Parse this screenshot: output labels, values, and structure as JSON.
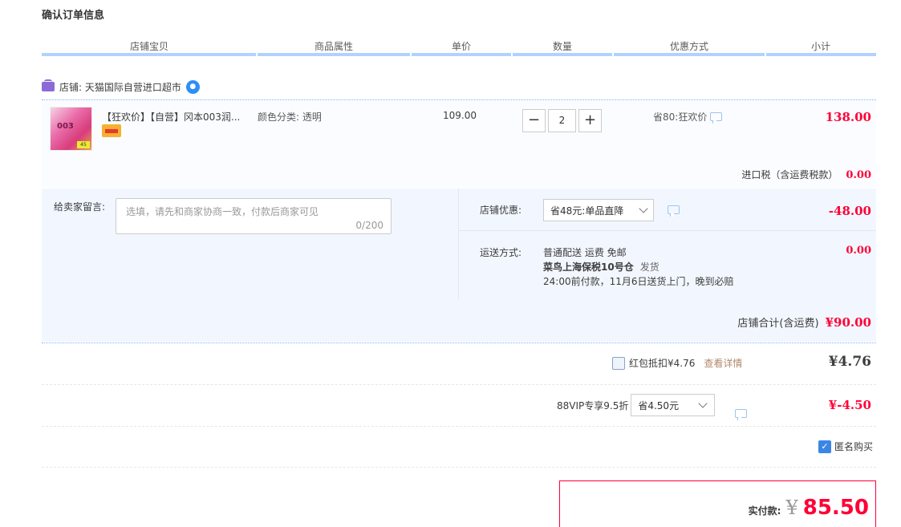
{
  "page": {
    "title": "确认订单信息"
  },
  "columns": [
    "店铺宝贝",
    "商品属性",
    "单价",
    "数量",
    "优惠方式",
    "小计"
  ],
  "shop": {
    "label": "店铺: 天猫国际自营进口超市"
  },
  "item": {
    "title": "【狂欢价】【自营】冈本003润...",
    "attribute": "颜色分类: 透明",
    "price": "109.00",
    "quantity": "2",
    "minus": "−",
    "plus": "+",
    "promo": "省80:狂欢价",
    "subtotal": "138.00",
    "thumb_text": "003",
    "thumb_badge": "45",
    "tax_label": "进口税（含运费税款）",
    "tax_value": "0.00"
  },
  "message": {
    "label": "给卖家留言:",
    "placeholder": "选填，请先和商家协商一致，付款后商家可见",
    "counter": "0/200"
  },
  "shop_discount": {
    "label": "店铺优惠:",
    "selected": "省48元:单品直降",
    "value": "-48.00"
  },
  "shipping": {
    "label": "运送方式:",
    "line1": "普通配送 运费 免邮",
    "line2_bold": "菜鸟上海保税10号仓",
    "line2_suffix": "发货",
    "line3": "24:00前付款，11月6日送货上门，晚到必赔",
    "value": "0.00"
  },
  "shop_total": {
    "label": "店铺合计(含运费)",
    "value": "¥90.00"
  },
  "red_packet": {
    "label": "红包抵扣¥4.76",
    "link": "查看详情",
    "value": "¥4.76",
    "checked": false
  },
  "vip": {
    "label": "88VIP专享9.5折",
    "selected": "省4.50元",
    "value": "¥-4.50"
  },
  "anonymous": {
    "label": "匿名购买",
    "checked": true
  },
  "payment": {
    "label": "实付款:",
    "currency": "¥",
    "amount": "85.50"
  },
  "colors": {
    "accent_red": "#ff0036",
    "header_line": "#b2d1ff",
    "panel_bg": "#f2f7ff"
  }
}
